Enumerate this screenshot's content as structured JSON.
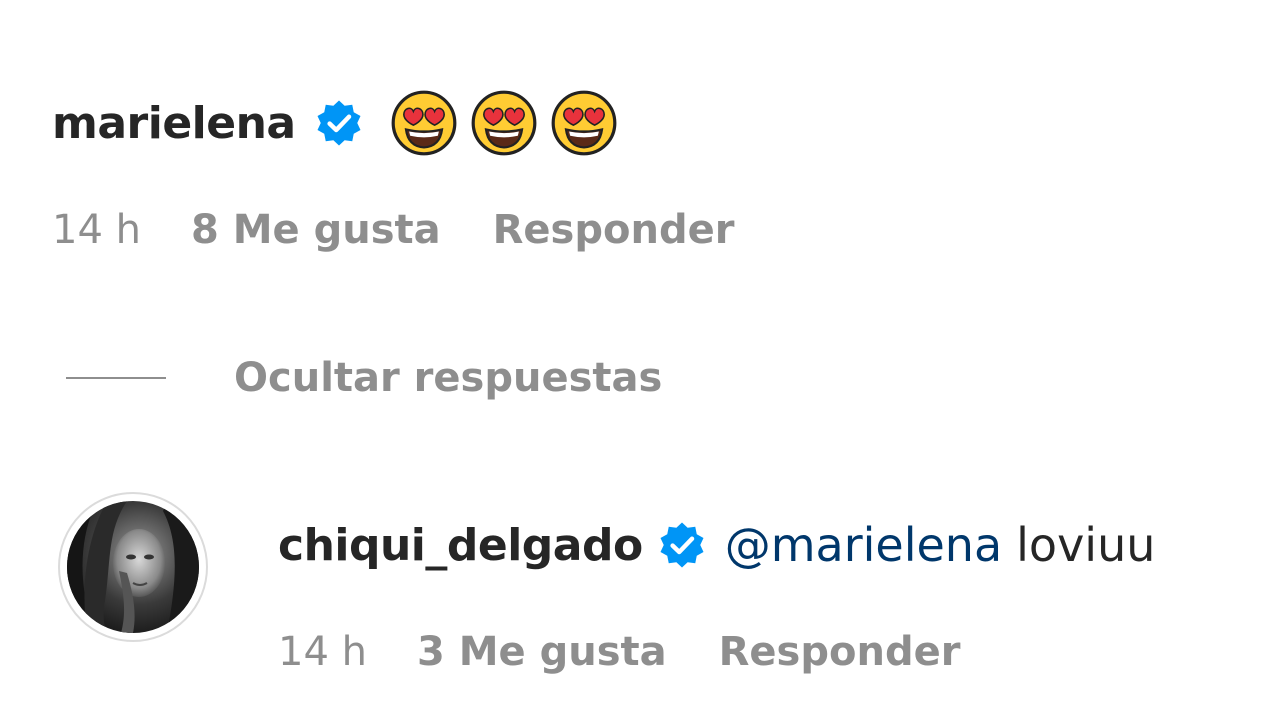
{
  "comment": {
    "username": "marielena",
    "verified": true,
    "emoji_icons": [
      "heart-eyes-emoji-icon",
      "heart-eyes-emoji-icon",
      "heart-eyes-emoji-icon"
    ],
    "time": "14 h",
    "likes": "8 Me gusta",
    "reply_label": "Responder"
  },
  "replies_toggle": {
    "label": "Ocultar respuestas"
  },
  "reply": {
    "username": "chiqui_delgado",
    "verified": true,
    "avatar_icon": "avatar-photo",
    "mention": "@marielena",
    "text": "loviuu",
    "time": "14 h",
    "likes": "3 Me gusta",
    "reply_label": "Responder"
  },
  "colors": {
    "username": "#262626",
    "meta": "#8e8e8e",
    "mention": "#00376b",
    "verified_badge": "#0095f6"
  }
}
